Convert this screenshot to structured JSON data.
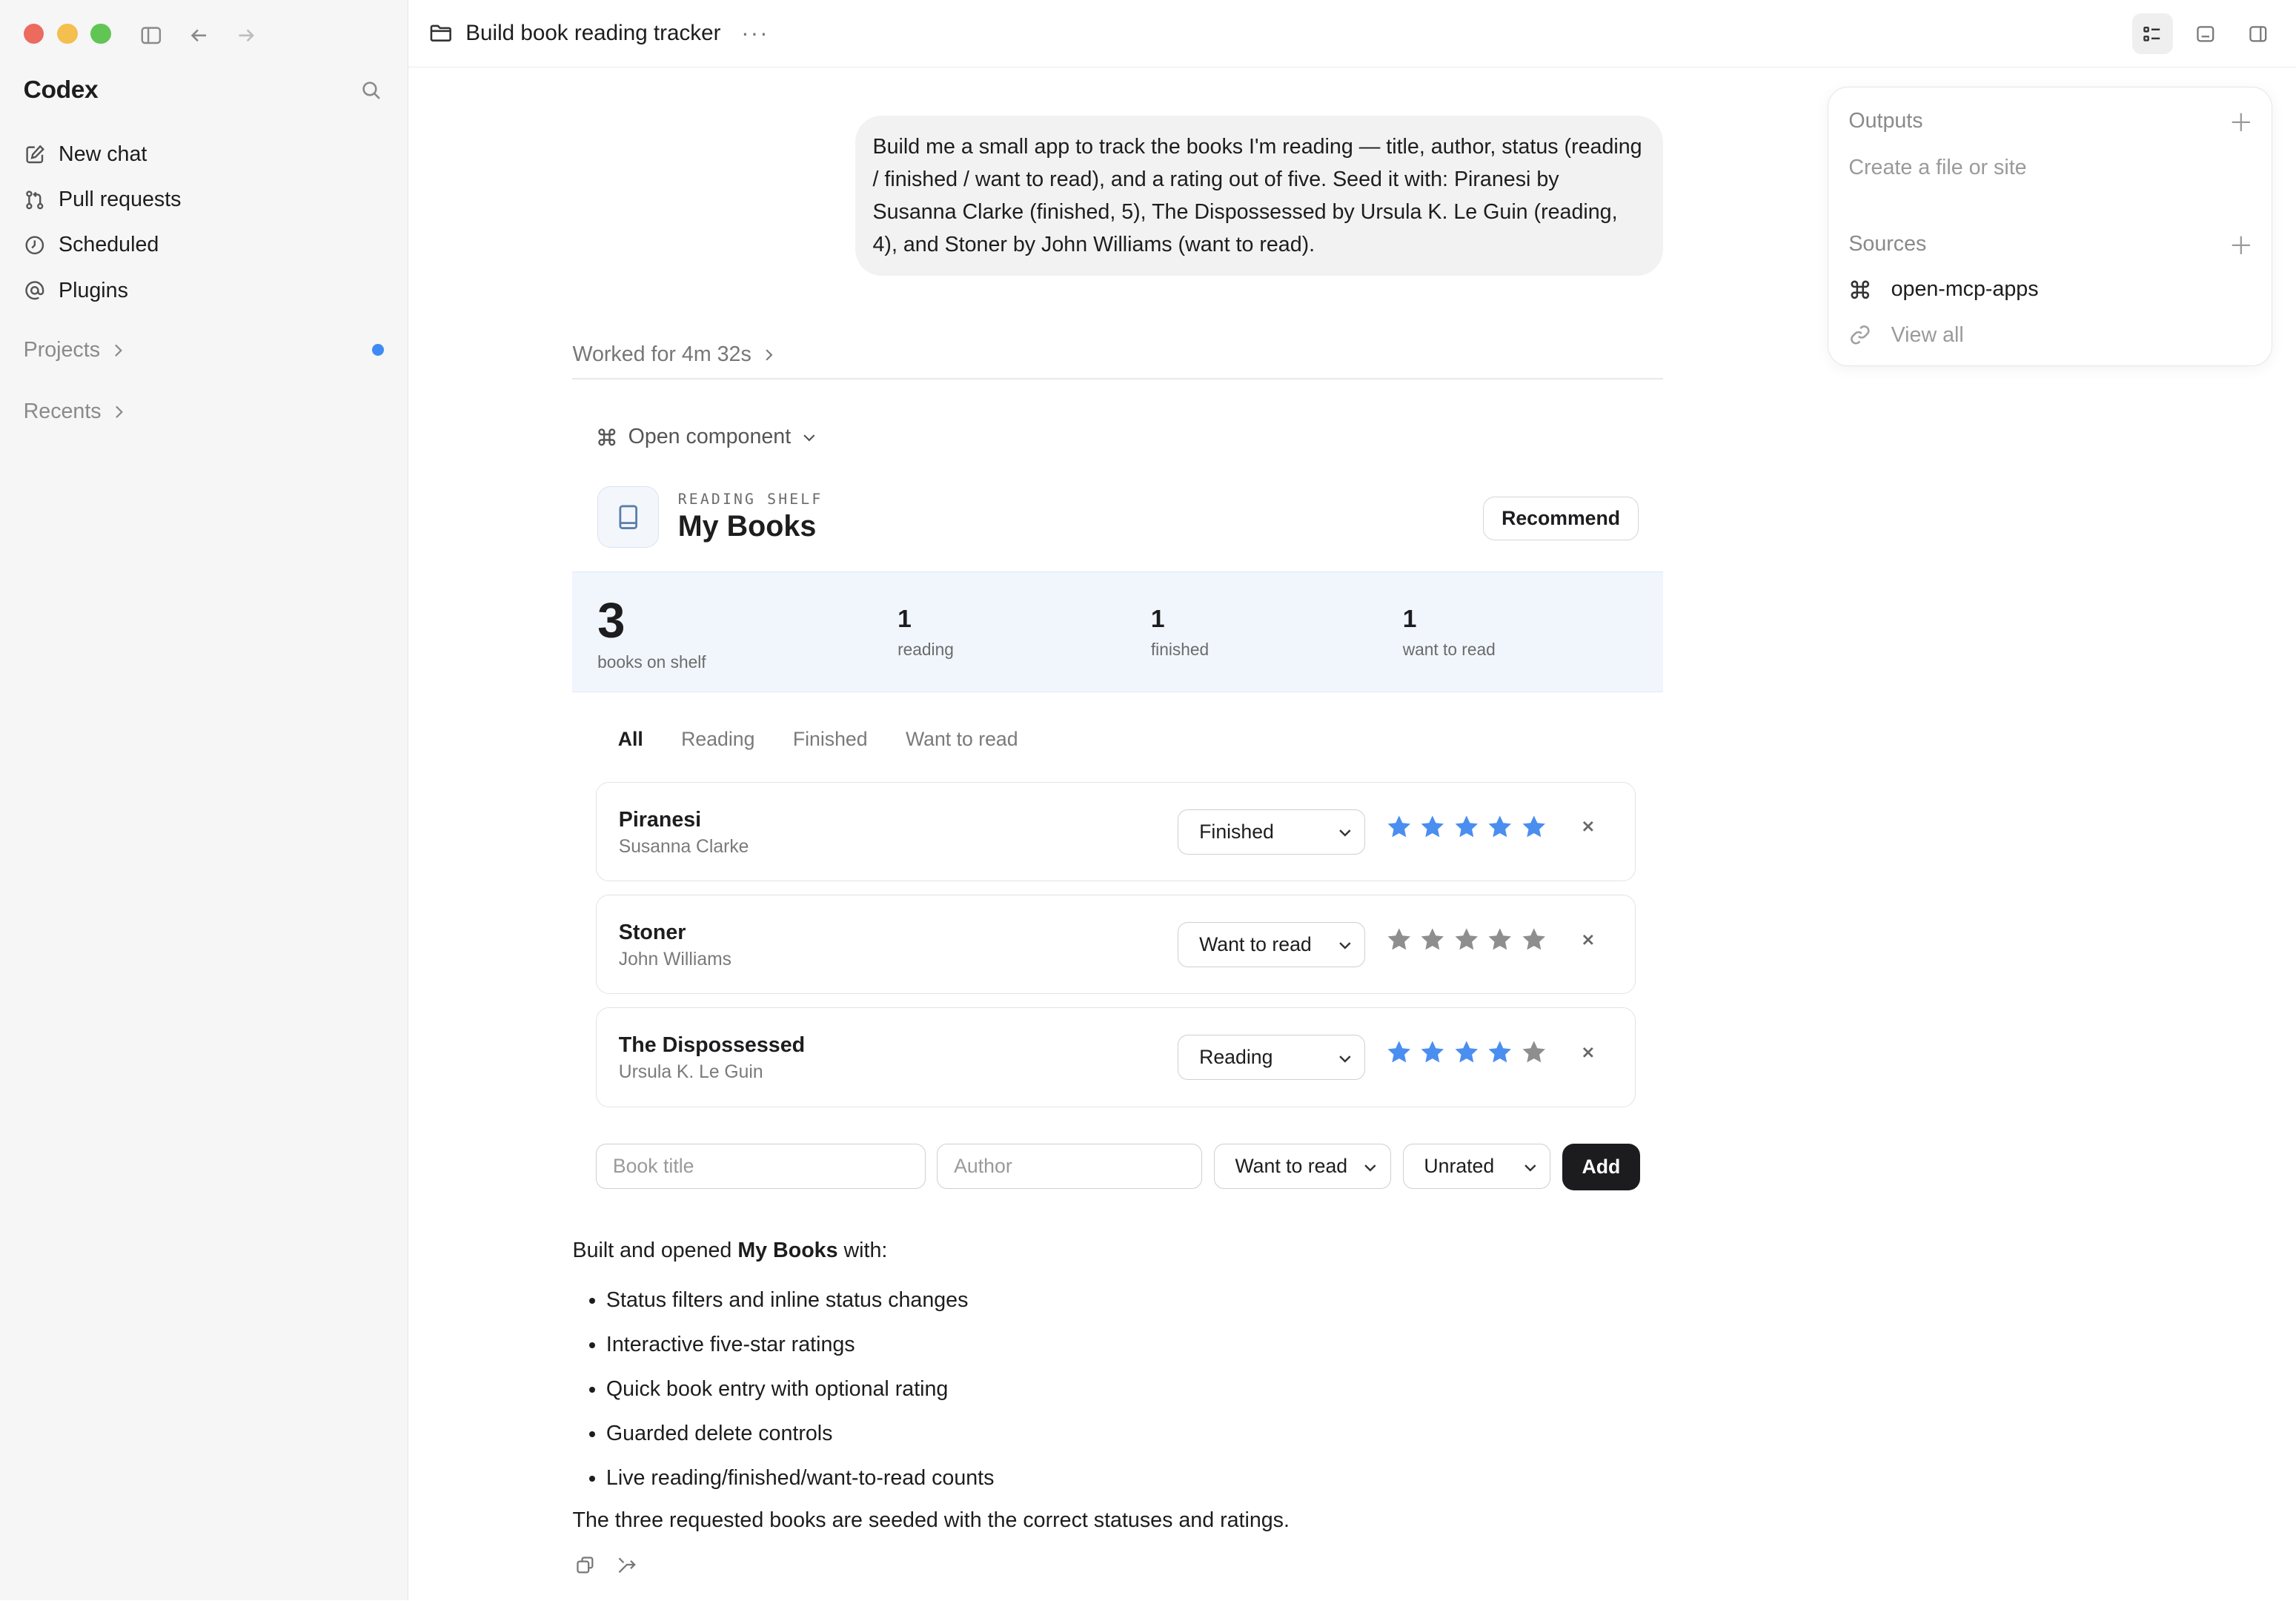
{
  "sidebar": {
    "brand": "Codex",
    "nav": [
      {
        "label": "New chat",
        "icon": "pencil-square-icon"
      },
      {
        "label": "Pull requests",
        "icon": "git-pull-request-icon"
      },
      {
        "label": "Scheduled",
        "icon": "clock-icon"
      },
      {
        "label": "Plugins",
        "icon": "at-sign-icon"
      }
    ],
    "projects_label": "Projects",
    "recents_label": "Recents"
  },
  "topbar": {
    "title": "Build book reading tracker",
    "more": "···"
  },
  "panel": {
    "outputs_label": "Outputs",
    "outputs_hint": "Create a file or site",
    "sources_label": "Sources",
    "source_item": "open-mcp-apps",
    "view_all": "View all"
  },
  "chat": {
    "user_message": "Build me a small app to track the books I'm reading — title, author, status (reading / finished / want to read), and a rating out of five. Seed it with: Piranesi by Susanna Clarke (finished, 5), The Dispossessed by Ursula K. Le Guin (reading, 4), and Stoner by John Williams (want to read).",
    "worked_for": "Worked for 4m 32s",
    "open_component": "Open component"
  },
  "app": {
    "eyebrow": "READING SHELF",
    "title": "My Books",
    "recommend_label": "Recommend",
    "stats": {
      "total": "3",
      "total_label": "books on shelf",
      "reading": "1",
      "reading_label": "reading",
      "finished": "1",
      "finished_label": "finished",
      "want": "1",
      "want_label": "want to read"
    },
    "tabs": [
      "All",
      "Reading",
      "Finished",
      "Want to read"
    ],
    "active_tab": "All",
    "books": [
      {
        "title": "Piranesi",
        "author": "Susanna Clarke",
        "status": "Finished",
        "rating": 5
      },
      {
        "title": "Stoner",
        "author": "John Williams",
        "status": "Want to read",
        "rating": 0
      },
      {
        "title": "The Dispossessed",
        "author": "Ursula K. Le Guin",
        "status": "Reading",
        "rating": 4
      }
    ],
    "form": {
      "title_placeholder": "Book title",
      "author_placeholder": "Author",
      "status_value": "Want to read",
      "rating_value": "Unrated",
      "add_label": "Add"
    }
  },
  "summary": {
    "intro_prefix": "Built and opened ",
    "intro_bold": "My Books",
    "intro_suffix": " with:",
    "bullets": [
      "Status filters and inline status changes",
      "Interactive five-star ratings",
      "Quick book entry with optional rating",
      "Guarded delete controls",
      "Live reading/finished/want-to-read counts"
    ],
    "outro": "The three requested books are seeded with the correct statuses and ratings."
  },
  "colors": {
    "star_on": "#4a8ef0",
    "star_off": "#8e8e8e",
    "accent_dot": "#3e8bf5"
  }
}
